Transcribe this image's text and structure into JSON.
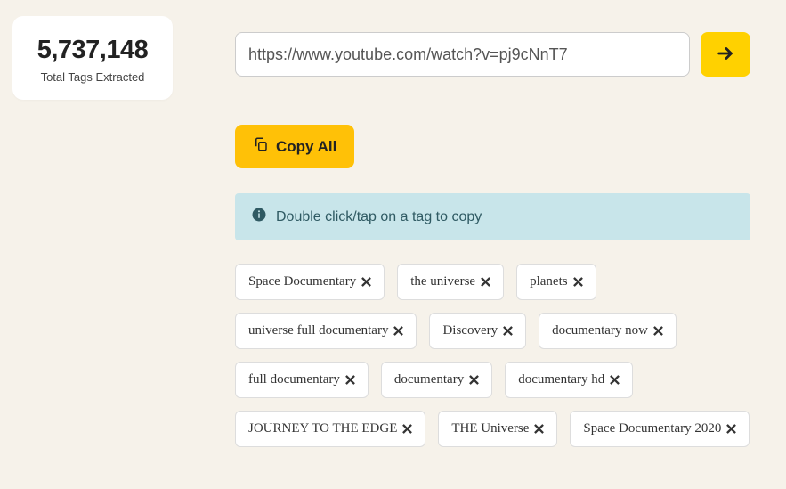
{
  "stats": {
    "count": "5,737,148",
    "label": "Total Tags Extracted"
  },
  "input": {
    "value": "https://www.youtube.com/watch?v=pj9cNnT7"
  },
  "copy_all_label": "Copy All",
  "info_text": "Double click/tap on a tag to copy",
  "tags": [
    "Space Documentary",
    "the universe",
    "planets",
    "universe full documentary",
    "Discovery",
    "documentary now",
    "full documentary",
    "documentary",
    "documentary hd",
    "JOURNEY TO THE EDGE",
    "THE Universe",
    "Space Documentary 2020"
  ]
}
